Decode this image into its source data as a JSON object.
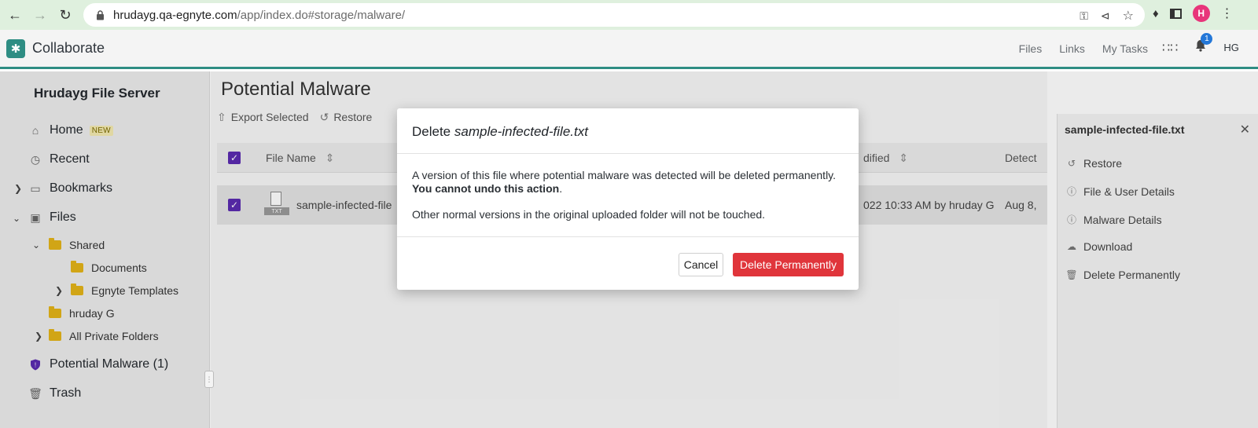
{
  "browser": {
    "url_host": "hrudayg.qa-egnyte.com",
    "url_path": "/app/index.do#storage/malware/",
    "profile_initial": "H"
  },
  "header": {
    "app_title": "Collaborate",
    "nav": [
      "Files",
      "Links",
      "My Tasks"
    ],
    "notification_count": "1",
    "user_initials": "HG",
    "accent_color": "#2e8d83"
  },
  "sidebar": {
    "server_name": "Hrudayg File Server",
    "home": "Home",
    "new_badge": "NEW",
    "recent": "Recent",
    "bookmarks": "Bookmarks",
    "files": "Files",
    "shared": "Shared",
    "documents": "Documents",
    "egnyte_templates": "Egnyte Templates",
    "hruday_g": "hruday G",
    "all_private_folders": "All Private Folders",
    "potential_malware": "Potential Malware (1)",
    "trash": "Trash"
  },
  "main": {
    "page_title": "Potential Malware",
    "toolbar": {
      "export_selected": "Export Selected",
      "restore": "Restore"
    },
    "columns": {
      "file_name": "File Name",
      "modified": "dified",
      "detected": "Detect"
    },
    "row": {
      "file_name": "sample-infected-file",
      "file_type": "TXT",
      "modified": "022 10:33 AM by hruday G",
      "detected": "Aug 8,"
    }
  },
  "panel": {
    "title": "sample-infected-file.txt",
    "items": [
      "Restore",
      "File & User Details",
      "Malware Details",
      "Download",
      "Delete Permanently"
    ]
  },
  "modal": {
    "title_prefix": "Delete",
    "title_file": "sample-infected-file.txt",
    "body_text": "A version of this file where potential malware was detected will be deleted permanently.",
    "body_warning": "You cannot undo this action",
    "body_end": ".",
    "body_note": "Other normal versions in the original uploaded folder will not be touched.",
    "cancel_label": "Cancel",
    "delete_label": "Delete Permanently",
    "delete_color": "#e0353b"
  }
}
